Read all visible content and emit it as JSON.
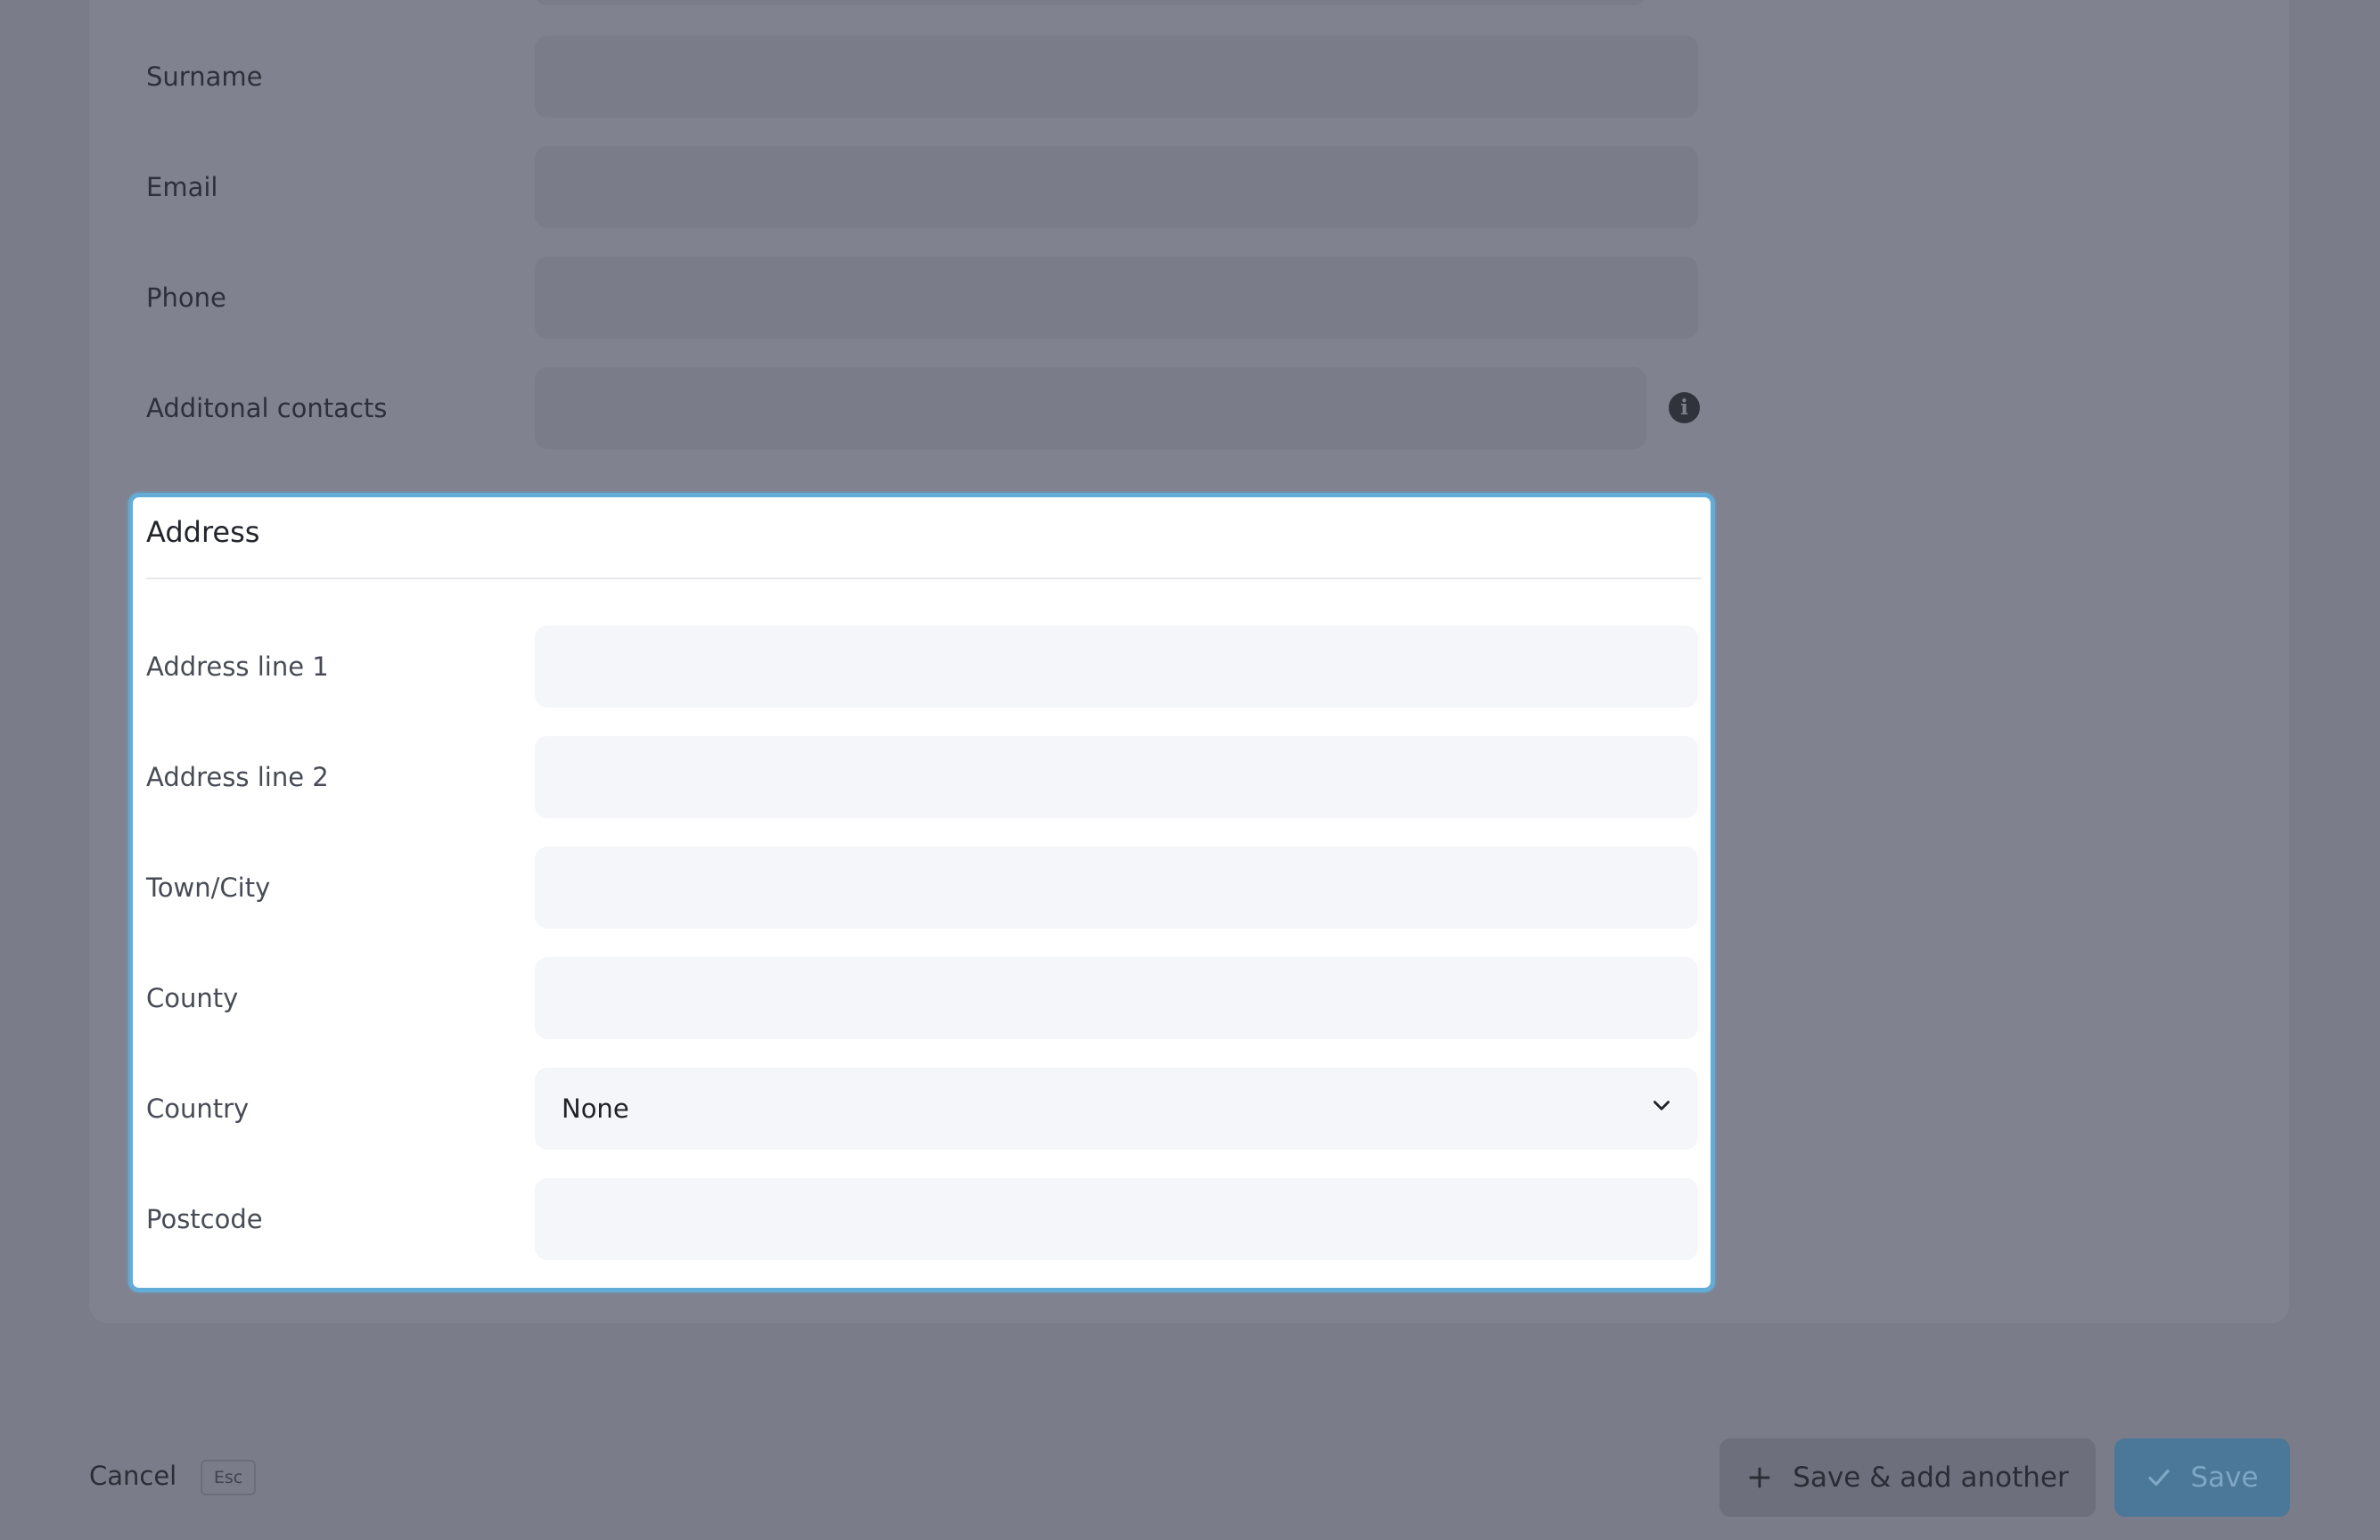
{
  "form": {
    "fields": [
      {
        "label": "Surname"
      },
      {
        "label": "Email"
      },
      {
        "label": "Phone"
      },
      {
        "label": "Additonal contacts"
      }
    ]
  },
  "address": {
    "title": "Address",
    "fields": [
      {
        "label": "Address line 1"
      },
      {
        "label": "Address line 2"
      },
      {
        "label": "Town/City"
      },
      {
        "label": "County"
      },
      {
        "label": "Country",
        "value": "None"
      },
      {
        "label": "Postcode"
      }
    ]
  },
  "footer": {
    "cancel_label": "Cancel",
    "cancel_shortcut": "Esc",
    "save_add_another_label": "Save & add another",
    "save_label": "Save"
  },
  "colors": {
    "overlay": "#7a7d89",
    "highlight_border": "#61add8",
    "primary_button": "#4b7798"
  }
}
